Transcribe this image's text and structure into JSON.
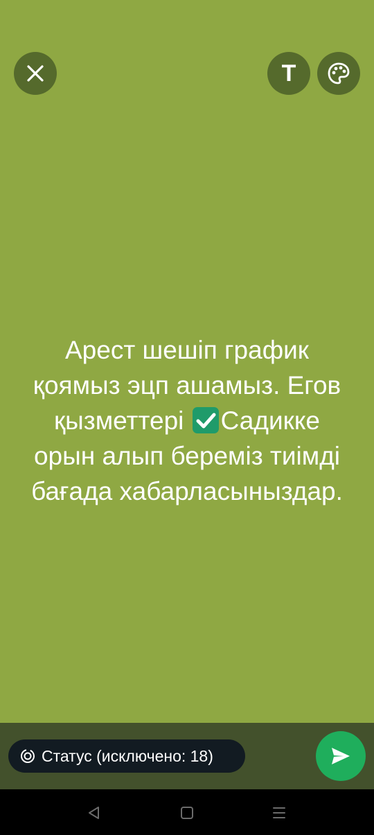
{
  "toolbar": {
    "close_icon": "close-icon",
    "text_button_label": "T",
    "palette_icon": "palette-icon"
  },
  "status": {
    "lines": [
      "Арест шешіп график",
      "қоямыз эцп ашамыз. Егов",
      "қызметтері ",
      "Садикке",
      "орын алып береміз тиімді",
      "бағада хабарласыныздар."
    ],
    "emoji": "check-mark-button-emoji",
    "text_color": "#ffffff",
    "background_color": "#8fa843"
  },
  "composer": {
    "audience_label": "Статус (исключено: 18)",
    "audience_icon": "status-ring-icon",
    "send_icon": "send-icon",
    "send_color": "#1fae5c"
  },
  "navigation": {
    "back_icon": "back-triangle-icon",
    "home_icon": "home-square-icon",
    "recents_icon": "menu-lines-icon"
  }
}
